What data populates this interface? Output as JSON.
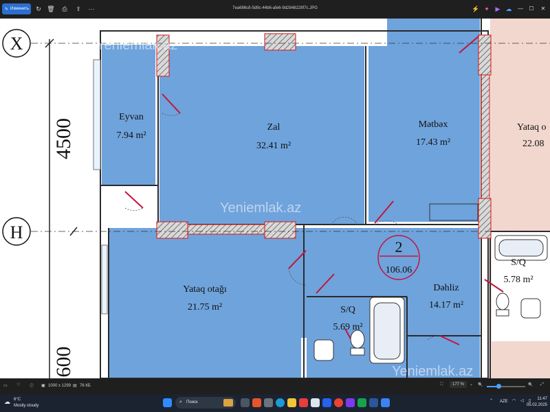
{
  "titlebar": {
    "edit_label": "Изменить",
    "filename": "7ea686c8-5d9c-44b6-afe6-9d2848228f7c.JPG",
    "more": "···"
  },
  "plan": {
    "axis_x": "X",
    "axis_h": "H",
    "dim_4500": "4500",
    "dim_600": "600",
    "watermark": "Yeniemlak.az",
    "unit_label": {
      "number": "2",
      "area": "106.06"
    },
    "rooms": [
      {
        "name": "Eyvan",
        "area": "7.94 m²"
      },
      {
        "name": "Zal",
        "area": "32.41 m²"
      },
      {
        "name": "Mətbəx",
        "area": "17.43 m²"
      },
      {
        "name": "Yataq otağı",
        "area": "22.08"
      },
      {
        "name": "Yataq otağı",
        "area": "21.75 m²"
      },
      {
        "name": "S/Q",
        "area": "5.69 m²"
      },
      {
        "name": "Dəhliz",
        "area": "14.17 m²"
      },
      {
        "name": "S/Q",
        "area": "5.78 m²"
      }
    ],
    "partial_room_name": "Yataq o"
  },
  "status": {
    "dimensions": "1000 x 1299",
    "size": "76 КБ",
    "zoom": "177 %"
  },
  "taskbar": {
    "temp": "6°C",
    "weather": "Mostly cloudy",
    "search_placeholder": "Поиск",
    "lang": "AZE",
    "time": "11:47",
    "date": "05.02.2025"
  }
}
